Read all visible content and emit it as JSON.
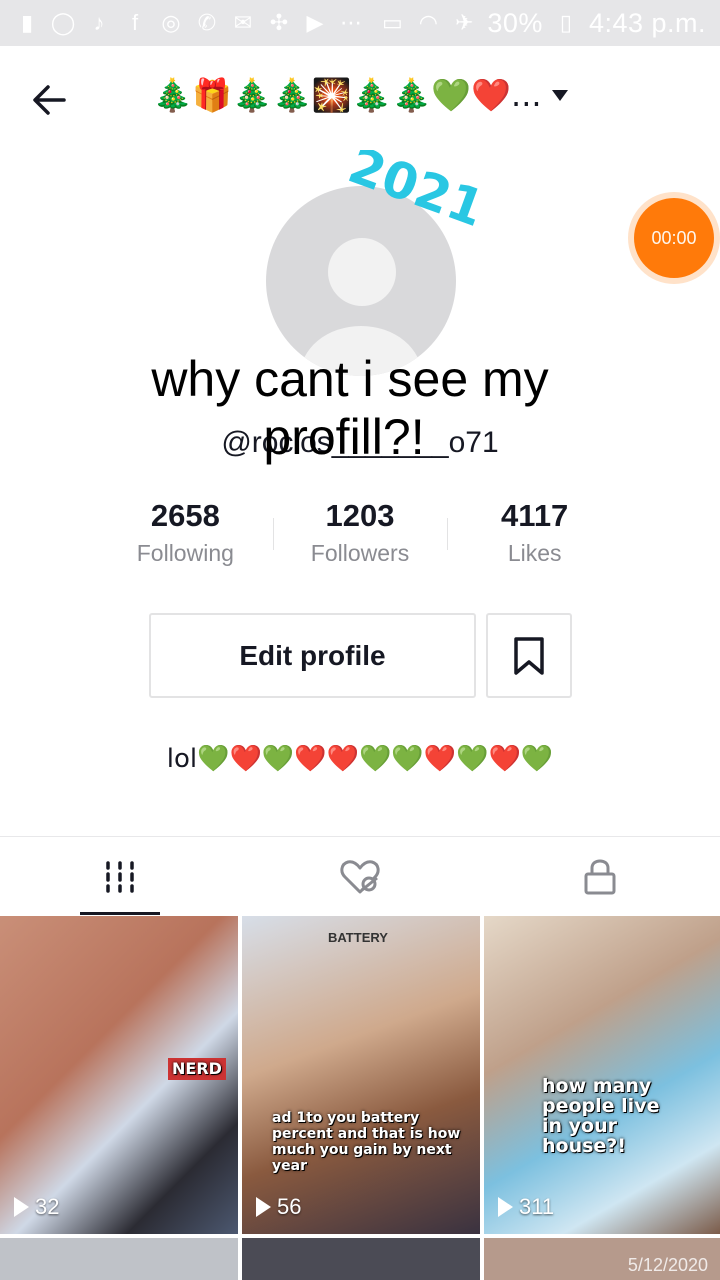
{
  "status_bar": {
    "battery_text": "30%",
    "time": "4:43 p.m.",
    "icons_left": [
      "notification-icon",
      "whatsapp-icon",
      "tiktok-icon",
      "facebook-icon",
      "messenger-icon",
      "call-icon",
      "gmail-icon",
      "app-icon",
      "video-icon",
      "more-icon"
    ],
    "icons_right": [
      "cast-icon",
      "wifi-icon",
      "airplane-icon",
      "battery-icon"
    ]
  },
  "header": {
    "title": "🎄🎁🎄🎄🎇🎄🎄💚❤️...",
    "caret_icon": "caret-down-icon"
  },
  "avatar": {
    "sticker_text": "2021"
  },
  "timer": {
    "label": "00:00"
  },
  "overlay_text": {
    "line1": "why cant i see my",
    "line2": "profill?!"
  },
  "username": "@rocios_______o71",
  "stats": [
    {
      "value": "2658",
      "label": "Following"
    },
    {
      "value": "1203",
      "label": "Followers"
    },
    {
      "value": "4117",
      "label": "Likes"
    }
  ],
  "edit_profile_label": "Edit profile",
  "bio": "lol💚❤️💚❤️❤️💚💚❤️💚❤️💚",
  "tabs": [
    {
      "name": "videos-grid-icon",
      "active": true
    },
    {
      "name": "liked-hidden-icon",
      "active": false
    },
    {
      "name": "lock-icon",
      "active": false
    }
  ],
  "videos": [
    {
      "views": "32",
      "caption": "NERD"
    },
    {
      "views": "56",
      "top_caption": "BATTERY",
      "caption": "ad 1to you battery percent and that is how much you gain by next year"
    },
    {
      "views": "311",
      "caption": "how many people live in your house?!"
    },
    {
      "views": ""
    },
    {
      "views": ""
    },
    {
      "views": "",
      "date": "5/12/2020"
    }
  ],
  "colors": {
    "timer": "#ff7a0a",
    "text": "#161823",
    "muted": "#8a8b91"
  }
}
